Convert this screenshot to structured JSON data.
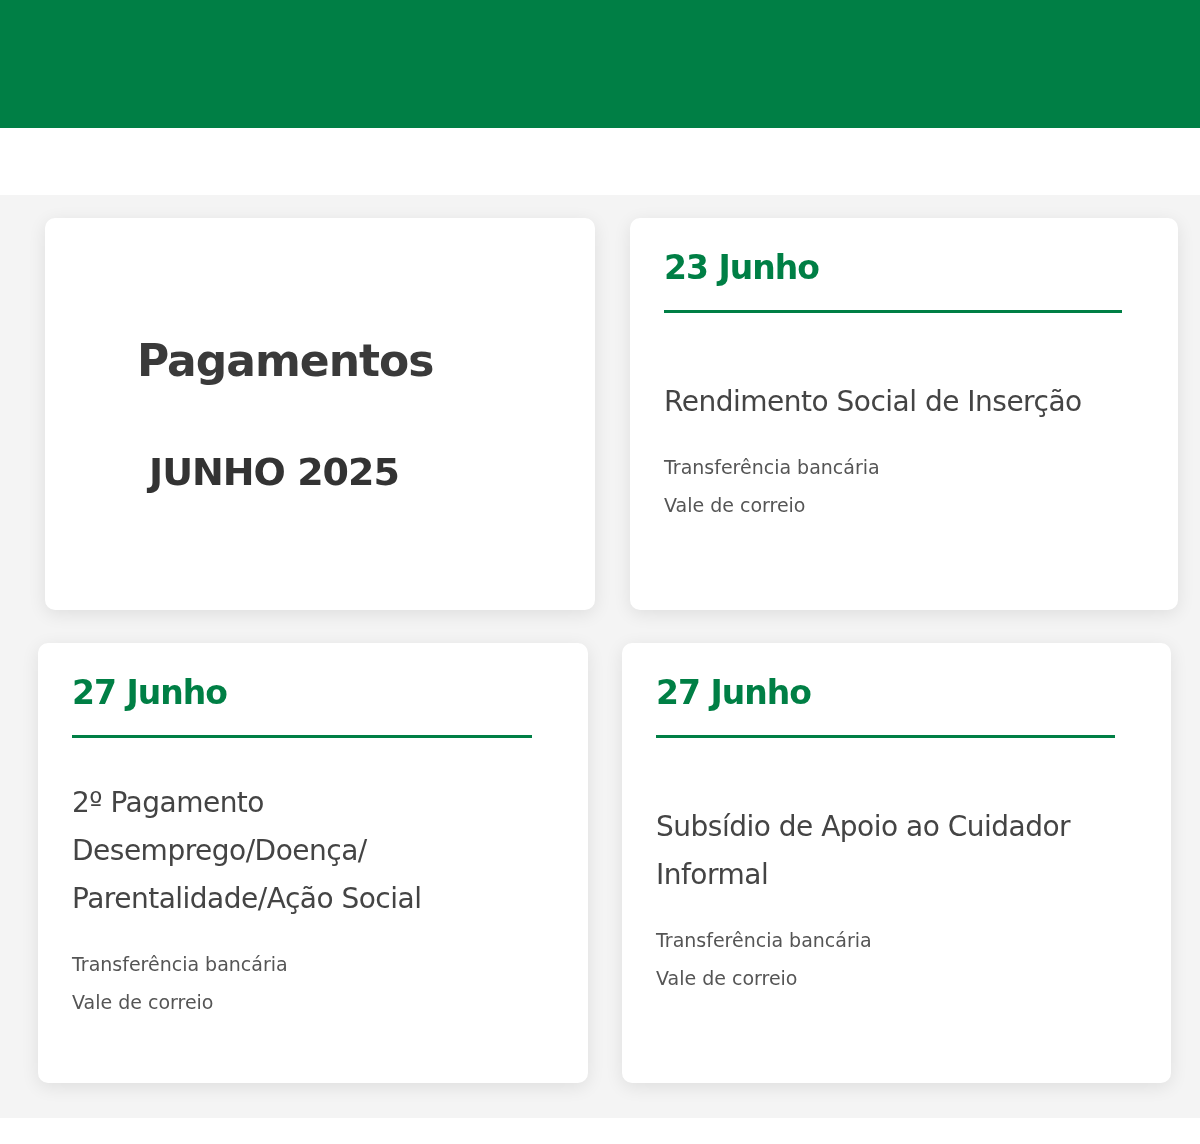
{
  "intro": {
    "title": "Pagamentos",
    "subtitle": "JUNHO 2025"
  },
  "cards": [
    {
      "date": "23 Junho",
      "title": "Rendimento Social de Inserção",
      "methods": [
        "Transferência bancária",
        "Vale de correio"
      ]
    },
    {
      "date": "27 Junho",
      "title": "2º Pagamento\nDesemprego/Doença/\nParentalidade/Ação Social",
      "methods": [
        "Transferência bancária",
        "Vale de correio"
      ]
    },
    {
      "date": "27 Junho",
      "title": "Subsídio de Apoio ao Cuidador\nInformal",
      "methods": [
        "Transferência bancária",
        "Vale de correio"
      ]
    }
  ]
}
